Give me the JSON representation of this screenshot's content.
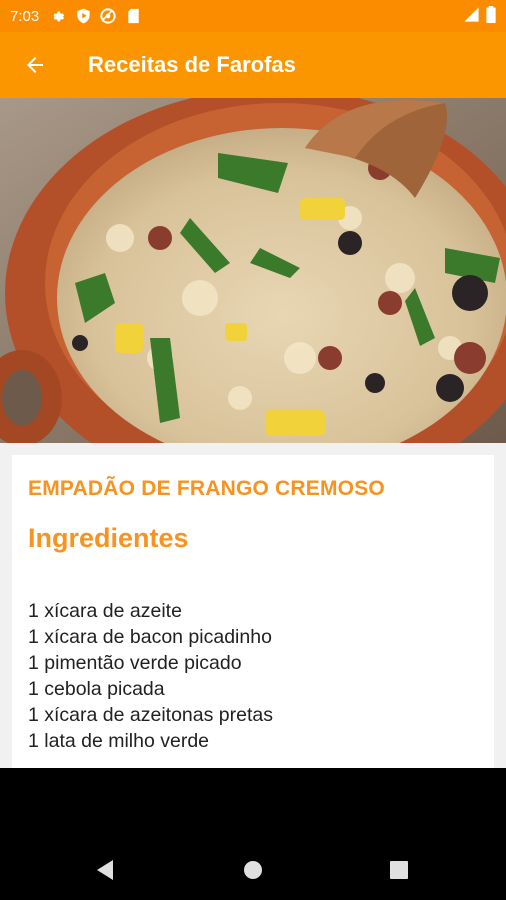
{
  "status_bar": {
    "time": "7:03",
    "icons": [
      "gear-icon",
      "shield-play-icon",
      "at-sign-icon",
      "sd-card-icon"
    ],
    "right_icons": [
      "signal-icon",
      "battery-icon"
    ]
  },
  "app_bar": {
    "title": "Receitas de Farofas",
    "back_icon": "arrow-back-icon",
    "color": "#FB9600"
  },
  "hero": {
    "description_icon": "farofa-dish-image"
  },
  "recipe": {
    "title": "EMPADÃO DE FRANGO CREMOSO",
    "section_title": "Ingredientes",
    "ingredients": [
      "1 xícara de azeite",
      "1 xícara de bacon picadinho",
      "1 pimentão verde picado",
      "1 cebola picada",
      "1 xícara de azeitonas pretas",
      "1 lata de milho verde"
    ],
    "accent_color": "#F7931E"
  },
  "nav_bar": {
    "buttons": [
      "nav-back-icon",
      "nav-home-icon",
      "nav-recents-icon"
    ]
  }
}
